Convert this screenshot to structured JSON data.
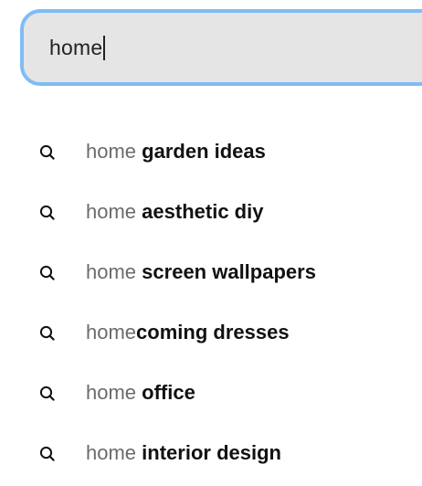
{
  "search": {
    "value": "home"
  },
  "suggestions": [
    {
      "prefix": "home",
      "separator": " ",
      "rest": "garden ideas",
      "icon": "search-icon"
    },
    {
      "prefix": "home",
      "separator": " ",
      "rest": "aesthetic diy",
      "icon": "search-icon"
    },
    {
      "prefix": "home",
      "separator": " ",
      "rest": "screen wallpapers",
      "icon": "search-icon"
    },
    {
      "prefix": "home",
      "separator": "",
      "rest": "coming dresses",
      "icon": "search-icon"
    },
    {
      "prefix": "home",
      "separator": " ",
      "rest": "office",
      "icon": "search-icon"
    },
    {
      "prefix": "home",
      "separator": " ",
      "rest": "interior design",
      "icon": "search-icon"
    }
  ],
  "colors": {
    "input_background": "#e5e5e5",
    "focus_ring": "#7fbcf7",
    "prefix_text": "#6b6b6b",
    "suggestion_text": "#111111"
  }
}
